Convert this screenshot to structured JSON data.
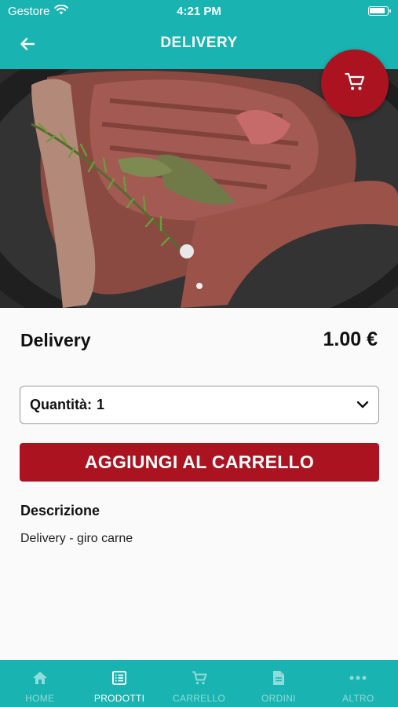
{
  "status_bar": {
    "carrier": "Gestore",
    "time": "4:21 PM"
  },
  "header": {
    "title": "DELIVERY"
  },
  "product": {
    "name": "Delivery",
    "price": "1.00 €",
    "quantity_label": "Quantità:",
    "quantity_value": "1",
    "add_button_label": "AGGIUNGI AL CARRELLO",
    "description_title": "Descrizione",
    "description_text": "Delivery - giro carne"
  },
  "tabs": [
    {
      "label": "HOME",
      "icon": "home-icon",
      "active": false
    },
    {
      "label": "PRODOTTI",
      "icon": "list-icon",
      "active": true
    },
    {
      "label": "CARRELLO",
      "icon": "cart-icon",
      "active": false
    },
    {
      "label": "ORDINI",
      "icon": "document-icon",
      "active": false
    },
    {
      "label": "ALTRO",
      "icon": "more-icon",
      "active": false
    }
  ],
  "colors": {
    "primary": "#19b3b1",
    "accent": "#ab1320",
    "tab_inactive": "#8edcdb"
  },
  "carousel": {
    "current": 1,
    "count": 1
  }
}
